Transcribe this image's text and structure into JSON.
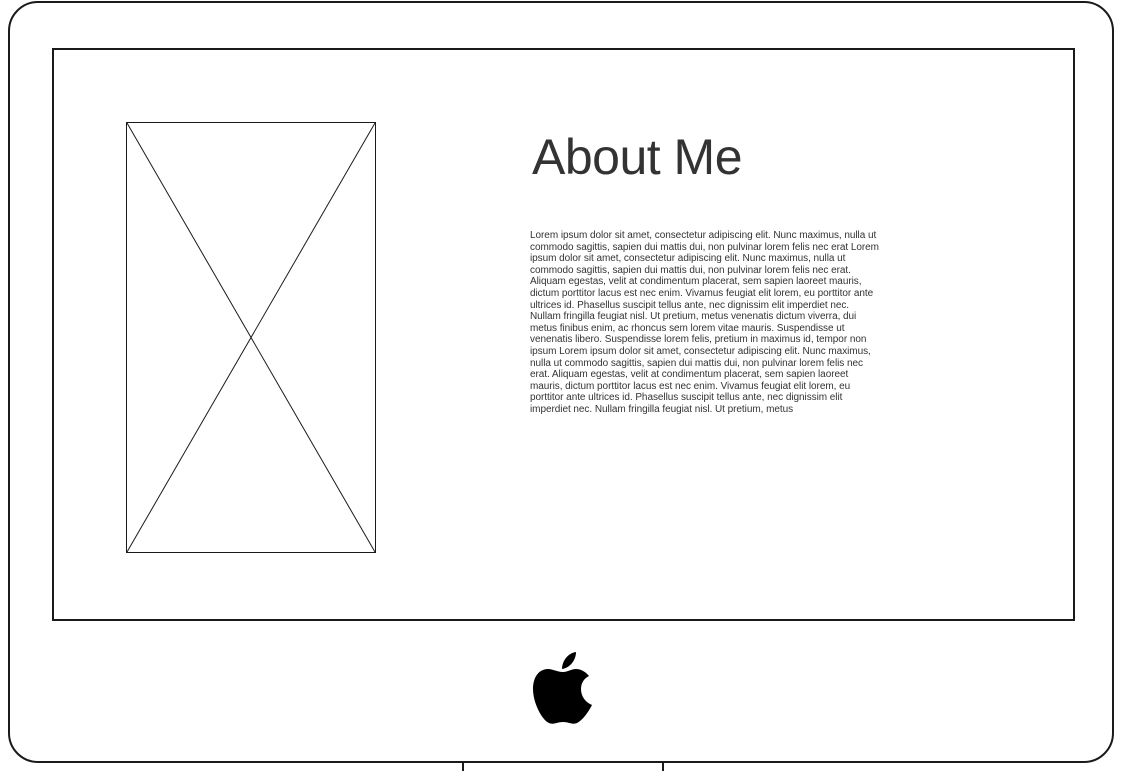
{
  "screen": {
    "heading": "About Me",
    "paragraph": "Lorem ipsum dolor sit amet, consectetur adipiscing elit. Nunc maximus, nulla ut commodo sagittis, sapien dui mattis dui, non pulvinar lorem felis nec erat Lorem ipsum dolor sit amet, consectetur adipiscing elit. Nunc maximus, nulla ut commodo sagittis, sapien dui mattis dui, non pulvinar lorem felis nec erat. Aliquam egestas, velit at condimentum placerat, sem sapien laoreet mauris, dictum porttitor lacus est nec enim. Vivamus feugiat elit lorem, eu porttitor ante ultrices id. Phasellus suscipit tellus ante, nec dignissim elit imperdiet nec. Nullam fringilla feugiat nisl. Ut pretium, metus venenatis dictum viverra, dui metus finibus enim, ac rhoncus sem lorem vitae mauris. Suspendisse ut venenatis libero. Suspendisse lorem felis, pretium in maximus id, tempor non ipsum Lorem ipsum dolor sit amet, consectetur adipiscing elit. Nunc maximus, nulla ut commodo sagittis, sapien dui mattis dui, non pulvinar lorem felis nec erat. Aliquam egestas, velit at condimentum placerat, sem sapien laoreet mauris, dictum porttitor lacus est nec enim. Vivamus feugiat elit lorem, eu porttitor ante ultrices id. Phasellus suscipit tellus ante, nec dignissim elit imperdiet nec. Nullam fringilla feugiat nisl. Ut pretium, metus",
    "image_placeholder_icon": "image-placeholder-icon"
  },
  "bezel": {
    "logo_icon": "apple-logo-icon"
  },
  "colors": {
    "outline": "#1a1a1a",
    "text": "#333333",
    "background": "#ffffff"
  }
}
